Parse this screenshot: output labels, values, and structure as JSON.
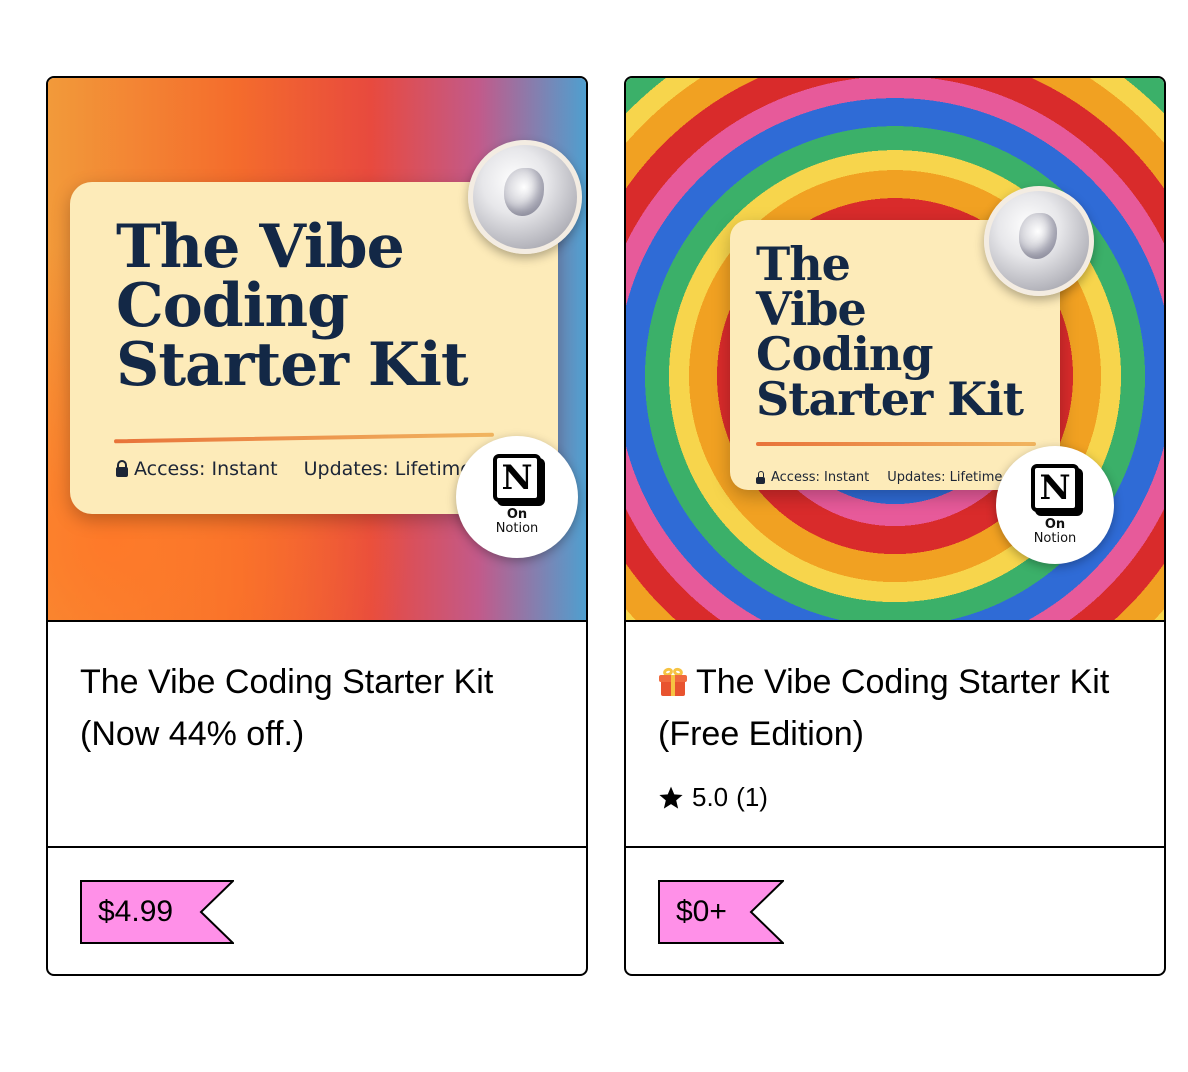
{
  "products": [
    {
      "cover": {
        "title": "The Vibe\nCoding\nStarter Kit",
        "access": "Access: Instant",
        "updates": "Updates: Lifetime",
        "badge_on": "On",
        "badge_name": "Notion",
        "badge_letter": "N"
      },
      "title": "The Vibe Coding Starter Kit (Now 44% off.)",
      "price": "$4.99"
    },
    {
      "cover": {
        "title": "The\nVibe\nCoding\nStarter Kit",
        "access": "Access: Instant",
        "updates": "Updates: Lifetime",
        "badge_on": "On",
        "badge_name": "Notion",
        "badge_letter": "N"
      },
      "title": "The Vibe Coding Starter Kit (Free Edition)",
      "title_icon": "gift-icon",
      "rating": {
        "score": "5.0",
        "count": "(1)",
        "icon": "star-icon"
      },
      "price": "$0+"
    }
  ],
  "colors": {
    "price_tag": "#ff90e8",
    "border": "#000000",
    "cover_panel": "#fdebb9",
    "cover_text": "#132846"
  }
}
